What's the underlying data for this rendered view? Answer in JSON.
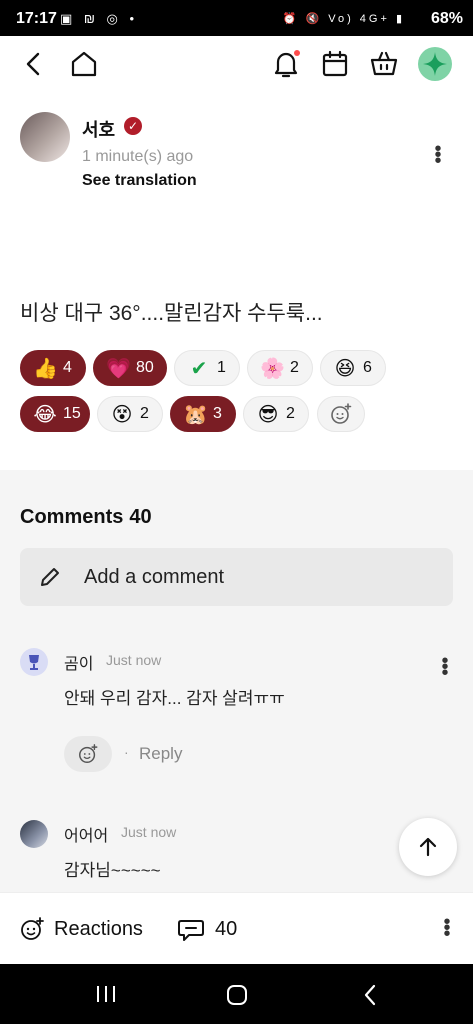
{
  "status_bar": {
    "time": "17:17",
    "left_icons": "▣ ₪ ◎ •",
    "right_icons": "⏰ 🔇 Vo) 4G+ ▮",
    "battery": "68%"
  },
  "author": {
    "name": "서호",
    "time": "1 minute(s) ago",
    "translate_label": "See translation"
  },
  "post": {
    "text": "비상 대구 36°....말린감자 수두룩..."
  },
  "reactions": [
    {
      "emoji": "👍",
      "count": "4",
      "active": true
    },
    {
      "emoji": "💗",
      "count": "80",
      "active": true
    },
    {
      "emoji": "✔",
      "count": "1",
      "active": false
    },
    {
      "emoji": "🌸",
      "count": "2",
      "active": false
    },
    {
      "emoji": "😆",
      "count": "6",
      "active": false
    },
    {
      "emoji": "😂",
      "count": "15",
      "active": true
    },
    {
      "emoji": "😵",
      "count": "2",
      "active": false
    },
    {
      "emoji": "🐹",
      "count": "3",
      "active": true
    },
    {
      "emoji": "😎",
      "count": "2",
      "active": false
    }
  ],
  "comments_section": {
    "title": "Comments",
    "count": "40",
    "add_placeholder": "Add a comment"
  },
  "comments": [
    {
      "name": "곰이",
      "time": "Just now",
      "text": "안돼 우리 감자... 감자 살려ㅠㅠ",
      "reply_label": "Reply",
      "separator": "·"
    },
    {
      "name": "어어어",
      "time": "Just now",
      "text": "감자님~~~~~"
    }
  ],
  "bottom_bar": {
    "reactions_label": "Reactions",
    "comments_count": "40"
  },
  "colors": {
    "active_pill": "#7a1d24",
    "verified": "#b11d2a",
    "accent_green": "#1a9e5c"
  }
}
